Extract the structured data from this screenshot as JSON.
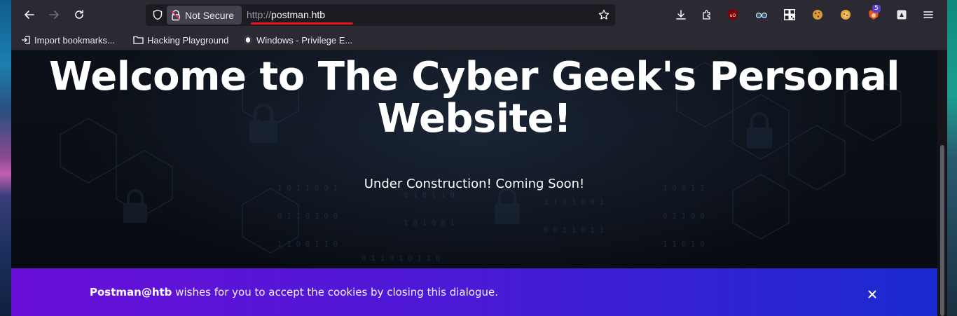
{
  "browser": {
    "security_label": "Not Secure",
    "url_scheme": "http://",
    "url_host": "postman.htb",
    "extensions_badge": "5",
    "colors": {
      "toolbar": "#2b2a33",
      "urlbar": "#1c1b22",
      "underline": "#e8151b"
    }
  },
  "bookmarks": [
    {
      "label": "Import bookmarks...",
      "icon": "import-icon"
    },
    {
      "label": "Hacking Playground",
      "icon": "folder-icon"
    },
    {
      "label": "Windows - Privilege E...",
      "icon": "site-favicon"
    }
  ],
  "page": {
    "title": "Welcome to The Cyber Geek's Personal Website!",
    "subtitle": "Under Construction! Coming Soon!"
  },
  "cookie_banner": {
    "brand": "Postman@htb",
    "message": " wishes for you to accept the cookies by closing this dialogue.",
    "close_label": "×"
  }
}
